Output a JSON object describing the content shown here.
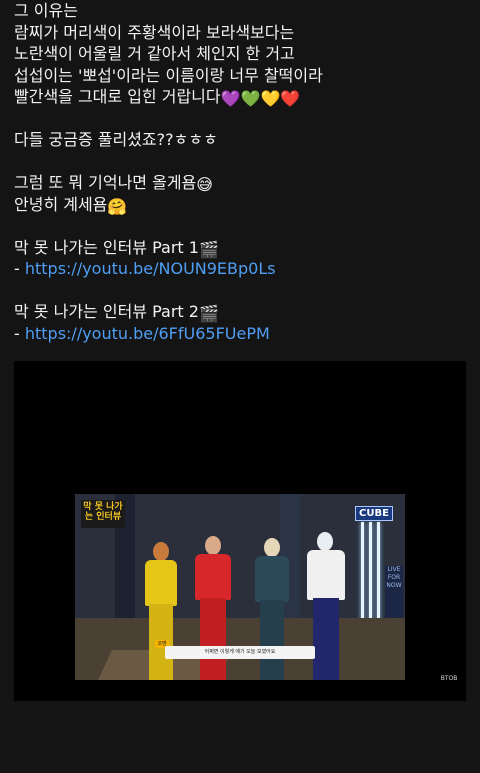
{
  "post": {
    "lines": [
      {
        "text": "그 이유는"
      },
      {
        "text": "람찌가 머리색이 주황색이라 보라색보다는"
      },
      {
        "text": "노란색이 어울릴 거 같아서 체인지 한 거고"
      },
      {
        "text": "섭섭이는 '뽀섭'이라는 이름이랑 너무 찰떡이라"
      },
      {
        "text": "빨간색을 그대로 입힌 거랍니다",
        "emoji": "💜💚💛❤️"
      },
      {
        "text": "다들 궁금증 풀리셨죠??ㅎㅎㅎ"
      },
      {
        "text": "그럼 또 뭐 기억나면 올게욤",
        "emoji": "😅"
      },
      {
        "text": "안녕히 계세욤",
        "emoji": "🤗"
      },
      {
        "text": "막 못 나가는 인터뷰 Part 1",
        "emoji": "🎬"
      },
      {
        "prefix": "- ",
        "link": "https://youtu.be/NOUN9EBp0Ls"
      },
      {
        "text": "막 못 나가는 인터뷰 Part 2",
        "emoji": "🎬"
      },
      {
        "prefix": "- ",
        "link": "https://youtu.be/6FfU65FUePM"
      }
    ]
  },
  "video": {
    "show_sign": "막 못 나가는 인터뷰",
    "cube_sign": "CUBE",
    "wall_panel": "LIVE FOR NOW",
    "caption_tag": "코멘",
    "caption": "어쩌면 이렇게 얘기 오늘 모였어요",
    "corner_logo": "BTOB",
    "colors": {
      "yellow_outfit": "#e6c619",
      "red_outfit": "#d8272a",
      "teal_outfit": "#2d4a5a",
      "navy_outfit": "#22266a"
    }
  }
}
